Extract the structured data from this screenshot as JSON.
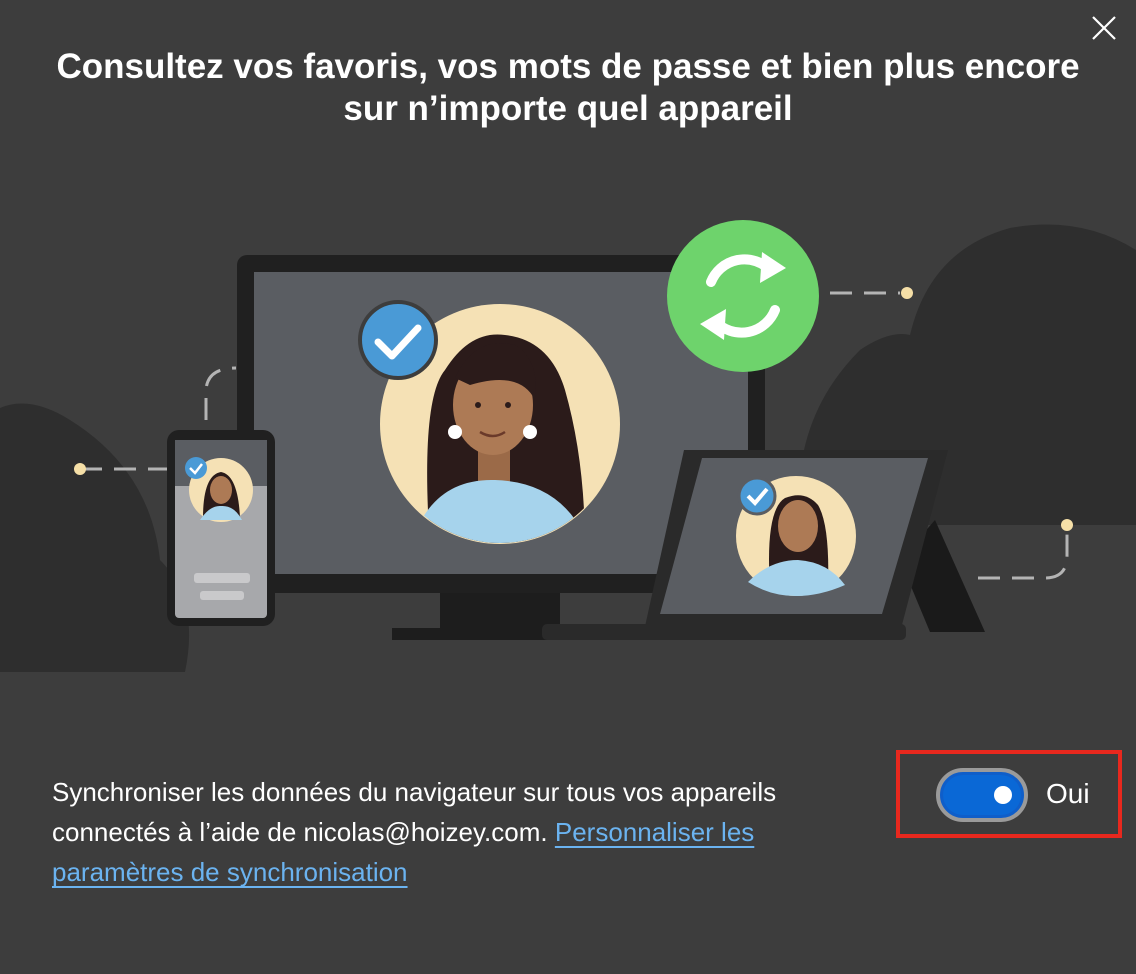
{
  "dialog": {
    "title_line1": "Consultez vos favoris, vos mots de passe et bien plus encore",
    "title_line2": "sur n’importe quel appareil",
    "close_label": "Fermer",
    "description_text": "Synchroniser les données du navigateur sur tous vos appareils connectés à l’aide de nicolas@hoizey.com. ",
    "customize_link": "Personnaliser les paramètres de synchronisation",
    "sync_toggle": {
      "state": "on",
      "label": "Oui"
    }
  },
  "colors": {
    "background": "#3d3d3d",
    "toggle_on": "#0a68d6",
    "link": "#6bb3f0",
    "highlight_border": "#e8281e",
    "sync_badge": "#6ed36c",
    "check_badge": "#4a9ad6"
  },
  "icons": [
    "close-icon",
    "sync-icon",
    "check-icon"
  ]
}
